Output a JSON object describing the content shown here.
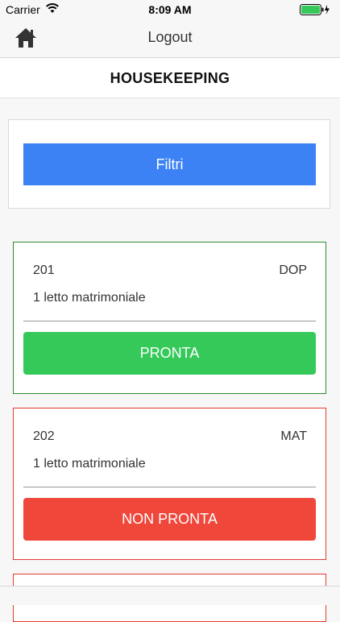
{
  "status_bar": {
    "carrier": "Carrier",
    "time": "8:09 AM",
    "wifi_icon": "wifi-icon",
    "battery_icon": "battery-full-icon"
  },
  "nav": {
    "home_icon": "home-icon",
    "logout_label": "Logout"
  },
  "page": {
    "title": "HOUSEKEEPING"
  },
  "filter": {
    "label": "Filtri",
    "color": "#3c82f5"
  },
  "rooms": [
    {
      "number": "201",
      "type": "DOP",
      "bed": "1 letto matrimoniale",
      "status": "PRONTA",
      "border_color": "#2e8b2e",
      "status_color": "#35c95a"
    },
    {
      "number": "202",
      "type": "MAT",
      "bed": "1 letto matrimoniale",
      "status": "NON PRONTA",
      "border_color": "#e23b32",
      "status_color": "#f0473b"
    }
  ]
}
